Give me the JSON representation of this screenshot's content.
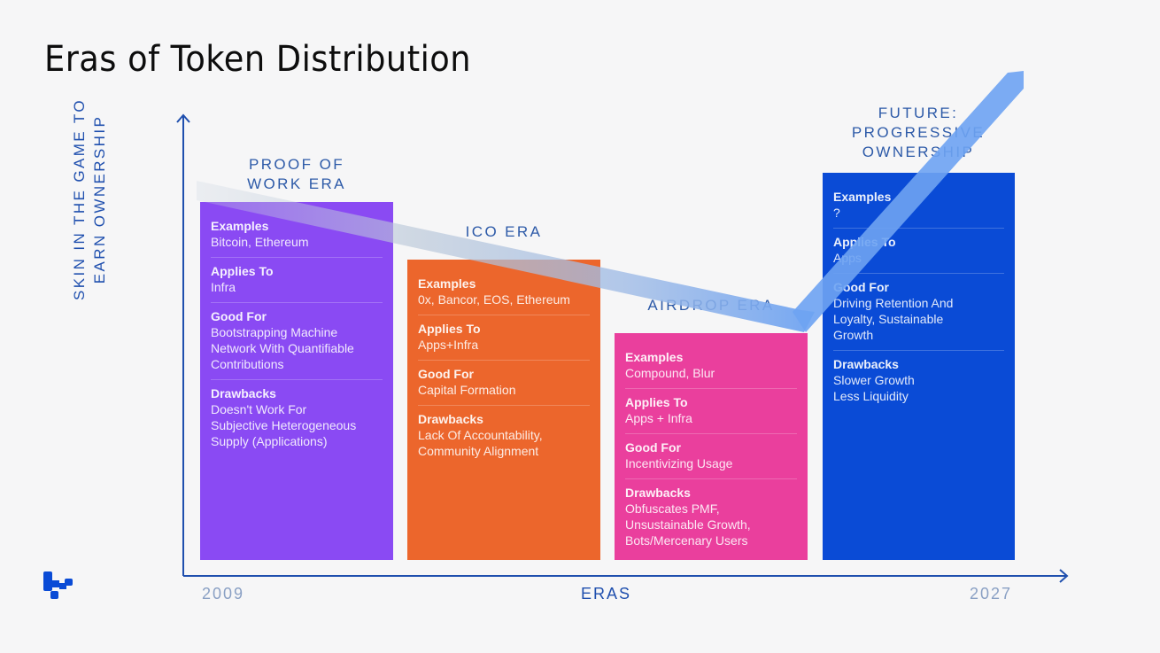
{
  "title": "Eras of Token Distribution",
  "axes": {
    "y_label": "SKIN IN THE GAME TO\nEARN OWNERSHIP",
    "x_label": "ERAS",
    "x_start": "2009",
    "x_end": "2027"
  },
  "eras": [
    {
      "name": "PROOF OF\nWORK ERA",
      "color": "#8a4af3",
      "sections": [
        {
          "heading": "Examples",
          "value": "Bitcoin, Ethereum"
        },
        {
          "heading": "Applies To",
          "value": "Infra"
        },
        {
          "heading": "Good For",
          "value": "Bootstrapping Machine\nNetwork With Quantifiable\nContributions"
        },
        {
          "heading": "Drawbacks",
          "value": "Doesn't Work For\nSubjective Heterogeneous\nSupply (Applications)"
        }
      ]
    },
    {
      "name": "ICO ERA",
      "color": "#ec662c",
      "sections": [
        {
          "heading": "Examples",
          "value": "0x, Bancor, EOS, Ethereum"
        },
        {
          "heading": "Applies To",
          "value": "Apps+Infra"
        },
        {
          "heading": "Good For",
          "value": "Capital Formation"
        },
        {
          "heading": "Drawbacks",
          "value": "Lack Of Accountability,\nCommunity Alignment"
        }
      ]
    },
    {
      "name": "AIRDROP ERA",
      "color": "#ea3f9d",
      "sections": [
        {
          "heading": "Examples",
          "value": "Compound, Blur"
        },
        {
          "heading": "Applies To",
          "value": "Apps + Infra"
        },
        {
          "heading": "Good For",
          "value": "Incentivizing Usage"
        },
        {
          "heading": "Drawbacks",
          "value": "Obfuscates PMF,\nUnsustainable Growth,\nBots/Mercenary Users"
        }
      ]
    },
    {
      "name": "FUTURE:\nPROGRESSIVE\nOWNERSHIP",
      "color": "#0a4bd6",
      "sections": [
        {
          "heading": "Examples",
          "value": "?"
        },
        {
          "heading": "Applies To",
          "value": "Apps"
        },
        {
          "heading": "Good For",
          "value": "Driving Retention And\nLoyalty, Sustainable\nGrowth"
        },
        {
          "heading": "Drawbacks",
          "value": "Slower Growth\nLess Liquidity"
        }
      ]
    }
  ],
  "colors": {
    "axis": "#1f4fae",
    "era_label": "#2d5aa8",
    "ribbon_grey": "#b9c7d8",
    "ribbon_blue": "#6ea3f2",
    "logo": "#0a4bd6"
  }
}
